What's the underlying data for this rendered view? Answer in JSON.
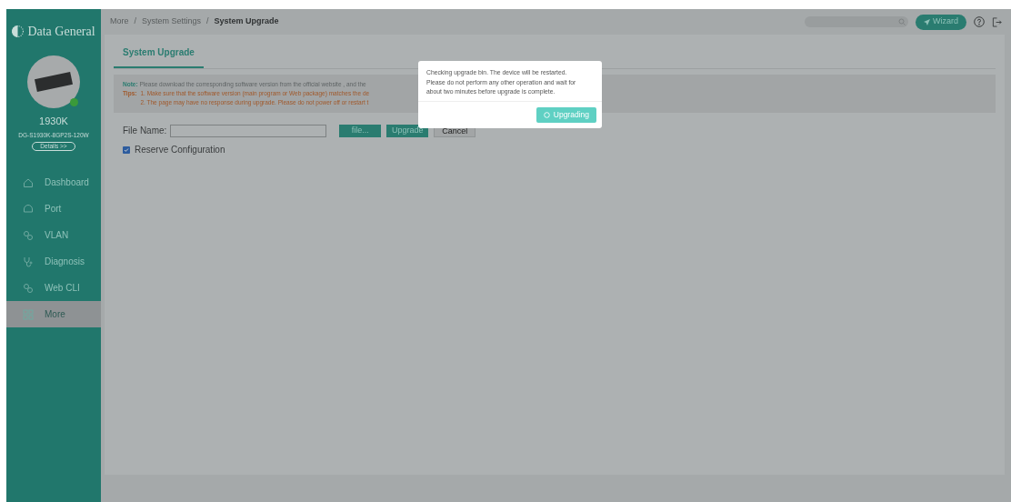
{
  "brand": {
    "name": "Data General"
  },
  "device": {
    "model": "1930K",
    "sku": "DG-S1930K-8GP2S-120W",
    "details_button": "Details >>"
  },
  "sidebar": {
    "items": [
      {
        "label": "Dashboard",
        "kind": "home",
        "selected": false
      },
      {
        "label": "Port",
        "kind": "port",
        "selected": false
      },
      {
        "label": "VLAN",
        "kind": "link",
        "selected": false
      },
      {
        "label": "Diagnosis",
        "kind": "diagnosis",
        "selected": false
      },
      {
        "label": "Web CLI",
        "kind": "link",
        "selected": false
      },
      {
        "label": "More",
        "kind": "grid",
        "selected": true
      }
    ]
  },
  "breadcrumb": [
    "More",
    "System Settings",
    "System Upgrade"
  ],
  "breadcrumb_separator": "/",
  "header": {
    "wizard_button": "Wizard"
  },
  "tabs": [
    {
      "label": "System Upgrade",
      "selected": true
    }
  ],
  "notice": {
    "note_label": "Note:",
    "note": "Please download the corresponding software version from the official website , and the",
    "tips_label": "Tips:",
    "tips": [
      "1. Make sure that the software version (main program or Web package) matches the de",
      "2. The page may have no response during upgrade. Please do not power off or restart t"
    ]
  },
  "form": {
    "file_label": "File Name:",
    "file_button": "file...",
    "upgrade_button": "Upgrade",
    "cancel_button": "Cancel",
    "reserve_label": "Reserve Configuration",
    "reserve_checked": true
  },
  "dialog": {
    "message": "Checking upgrade bin. The device will be restarted. Please do not perform any other operation and wait for about two minutes before upgrade is complete.",
    "button": "Upgrading"
  }
}
